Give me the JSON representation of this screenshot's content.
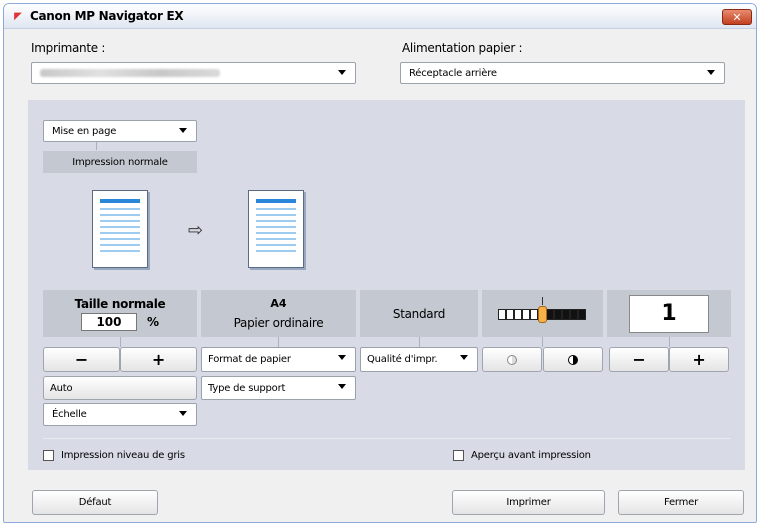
{
  "window": {
    "title": "Canon MP Navigator EX",
    "close_glyph": "✕"
  },
  "printer": {
    "label": "Imprimante :"
  },
  "paper_source": {
    "label": "Alimentation papier :",
    "value": "Réceptacle arrière"
  },
  "layout": {
    "dropdown": "Mise en page",
    "mode": "Impression normale"
  },
  "size": {
    "title": "Taille normale",
    "value": "100",
    "unit": "%",
    "minus": "−",
    "plus": "+",
    "auto": "Auto",
    "scale_dropdown": "Échelle"
  },
  "paper": {
    "size": "A4",
    "type": "Papier ordinaire",
    "format_dropdown": "Format de papier",
    "media_dropdown": "Type de support"
  },
  "quality": {
    "value": "Standard",
    "dropdown": "Qualité d'impr."
  },
  "density": {
    "level": 0.5
  },
  "copies": {
    "value": "1",
    "minus": "−",
    "plus": "+"
  },
  "options": {
    "grayscale": "Impression niveau de gris",
    "preview": "Aperçu avant impression"
  },
  "footer": {
    "default": "Défaut",
    "print": "Imprimer",
    "close": "Fermer"
  }
}
